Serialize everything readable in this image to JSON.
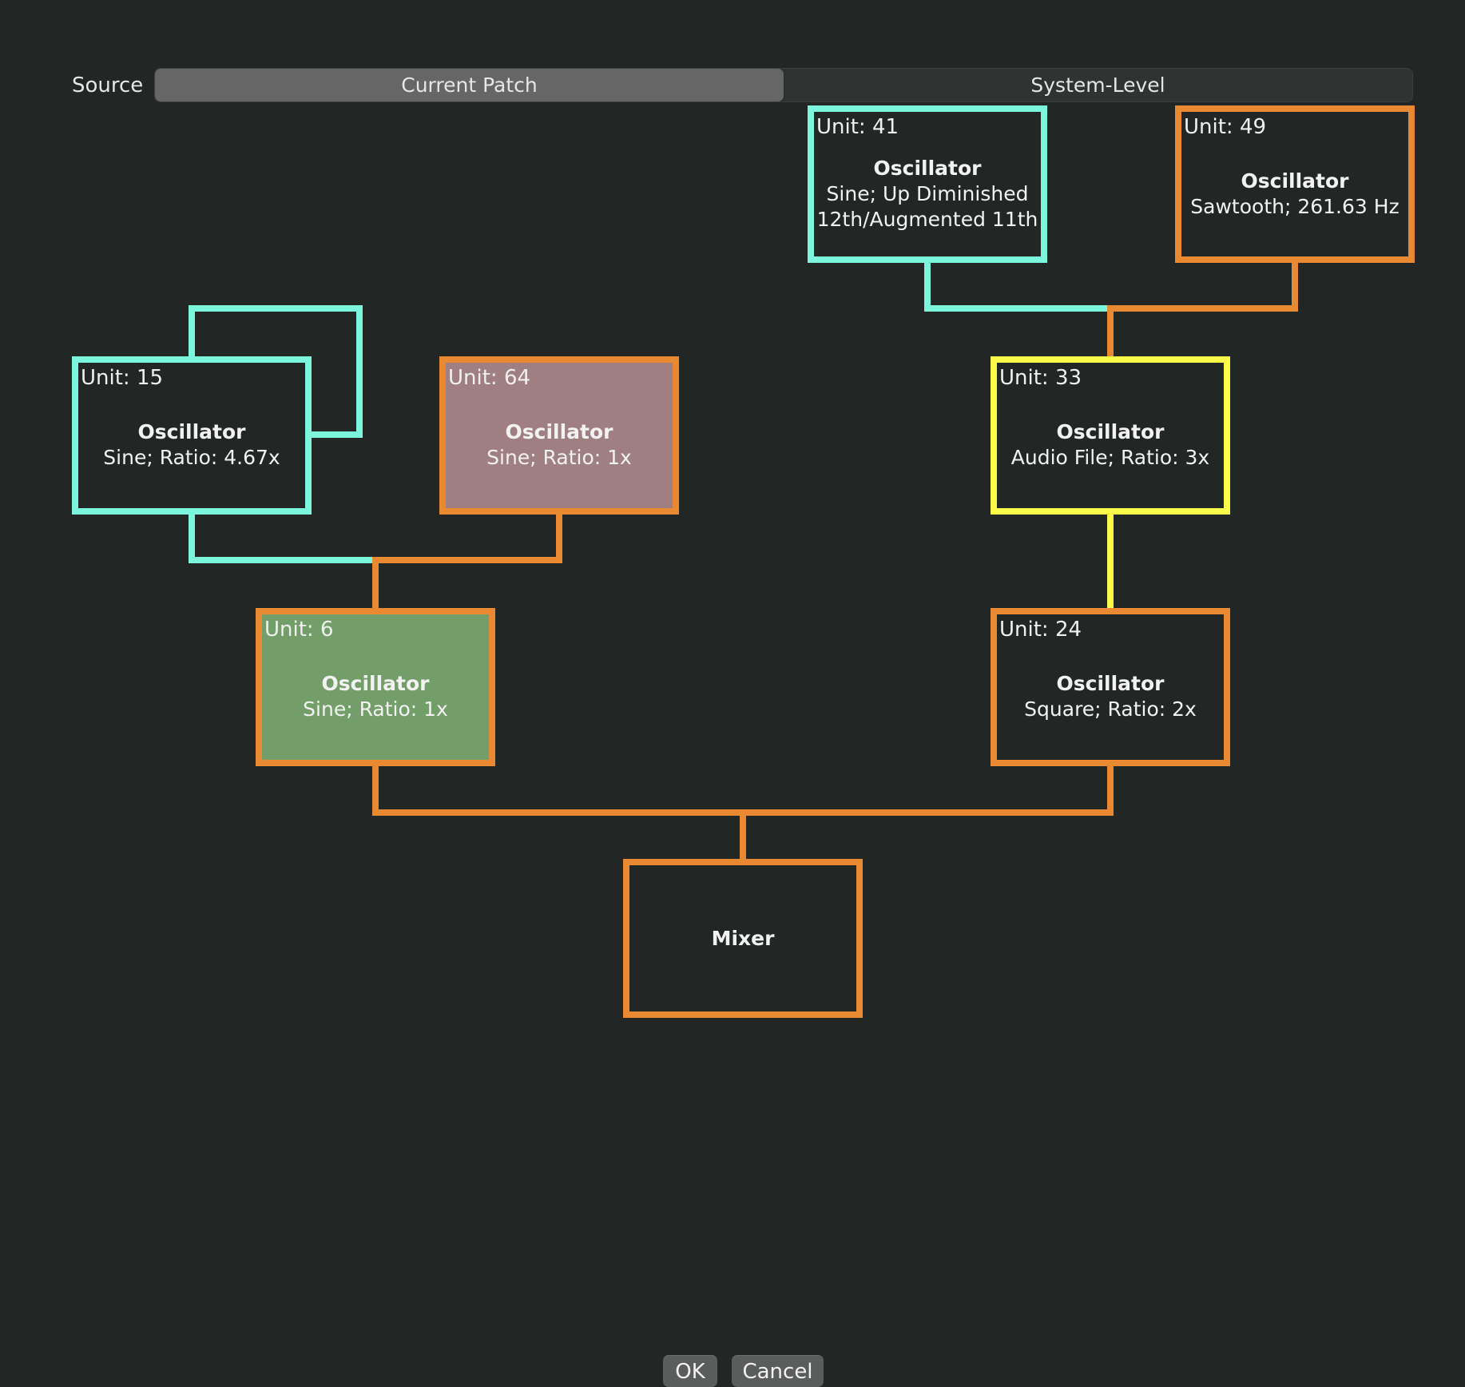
{
  "source": {
    "label": "Source",
    "options": [
      "Current Patch",
      "System-Level"
    ],
    "selected": "Current Patch"
  },
  "colors": {
    "cyan": "#7CF6DC",
    "orange": "#E98A33",
    "yellow": "#FAFA48",
    "mauve_fill": "#A07F83",
    "green_fill": "#739E6A",
    "background": "#222625"
  },
  "nodes": {
    "n41": {
      "unit": "Unit: 41",
      "title": "Oscillator",
      "desc": "Sine; Up Diminished\n12th/Augmented 11th"
    },
    "n49": {
      "unit": "Unit: 49",
      "title": "Oscillator",
      "desc": "Sawtooth; 261.63 Hz"
    },
    "n15": {
      "unit": "Unit: 15",
      "title": "Oscillator",
      "desc": "Sine; Ratio: 4.67x"
    },
    "n64": {
      "unit": "Unit: 64",
      "title": "Oscillator",
      "desc": "Sine; Ratio: 1x"
    },
    "n33": {
      "unit": "Unit: 33",
      "title": "Oscillator",
      "desc": "Audio File; Ratio: 3x"
    },
    "n6": {
      "unit": "Unit: 6",
      "title": "Oscillator",
      "desc": "Sine; Ratio: 1x"
    },
    "n24": {
      "unit": "Unit: 24",
      "title": "Oscillator",
      "desc": "Square; Ratio: 2x"
    },
    "mixer": {
      "title": "Mixer"
    }
  },
  "buttons": {
    "ok": "OK",
    "cancel": "Cancel"
  }
}
